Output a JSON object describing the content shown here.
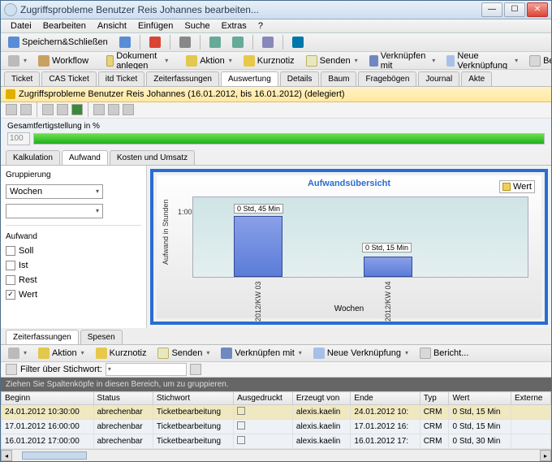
{
  "window": {
    "title": "Zugriffsprobleme Benutzer Reis Johannes bearbeiten..."
  },
  "menu": {
    "items": [
      "Datei",
      "Bearbeiten",
      "Ansicht",
      "Einfügen",
      "Suche",
      "Extras",
      "?"
    ]
  },
  "toolbar1": {
    "save_close": "Speichern&Schließen"
  },
  "toolbar2": {
    "workflow": "Workflow",
    "doc_create": "Dokument anlegen",
    "action": "Aktion",
    "shortnote": "Kurznotiz",
    "send": "Senden",
    "link_with": "Verknüpfen mit",
    "new_link": "Neue Verknüpfung",
    "report": "Bericht..."
  },
  "tabs": [
    "Ticket",
    "CAS Ticket",
    "itd Ticket",
    "Zeiterfassungen",
    "Auswertung",
    "Details",
    "Baum",
    "Fragebögen",
    "Journal",
    "Akte"
  ],
  "active_tab": "Auswertung",
  "infobar": "Zugriffsprobleme Benutzer Reis Johannes (16.01.2012, bis 16.01.2012) (delegiert)",
  "progress": {
    "label": "Gesamtfertigstellung in %",
    "value": "100"
  },
  "subtabs": [
    "Kalkulation",
    "Aufwand",
    "Kosten und Umsatz"
  ],
  "active_subtab": "Aufwand",
  "left": {
    "group_label": "Gruppierung",
    "group_value": "Wochen",
    "effort_label": "Aufwand",
    "checks": [
      {
        "label": "Soll",
        "checked": false
      },
      {
        "label": "Ist",
        "checked": false
      },
      {
        "label": "Rest",
        "checked": false
      },
      {
        "label": "Wert",
        "checked": true
      }
    ]
  },
  "chart_data": {
    "type": "bar",
    "title": "Aufwandsübersicht",
    "ylabel": "Aufwand in Stunden",
    "xlabel": "Wochen",
    "legend": [
      "Wert"
    ],
    "y_ticks": [
      "1:00"
    ],
    "categories": [
      "2012/KW 03",
      "2012/KW 04"
    ],
    "value_labels": [
      "0 Std, 45 Min",
      "0 Std, 15 Min"
    ],
    "values_minutes": [
      45,
      15
    ]
  },
  "lower_tabs": [
    "Zeiterfassungen",
    "Spesen"
  ],
  "active_lower_tab": "Zeiterfassungen",
  "lower_tb": {
    "action": "Aktion",
    "shortnote": "Kurznotiz",
    "send": "Senden",
    "link_with": "Verknüpfen mit",
    "new_link": "Neue Verknüpfung",
    "report": "Bericht..."
  },
  "filter": {
    "label": "Filter über Stichwort:"
  },
  "groupbar": "Ziehen Sie Spaltenköpfe in diesen Bereich, um zu gruppieren.",
  "columns": [
    "Beginn",
    "Status",
    "Stichwort",
    "Ausgedruckt",
    "Erzeugt von",
    "Ende",
    "Typ",
    "Wert",
    "Externe"
  ],
  "rows": [
    {
      "beginn": "24.01.2012 10:30:00",
      "status": "abrechenbar",
      "stichwort": "Ticketbearbeitung",
      "ausgedruckt": "",
      "von": "alexis.kaelin",
      "ende": "24.01.2012 10:",
      "typ": "CRM",
      "wert": "0 Std, 15  Min"
    },
    {
      "beginn": "17.01.2012 16:00:00",
      "status": "abrechenbar",
      "stichwort": "Ticketbearbeitung",
      "ausgedruckt": "",
      "von": "alexis.kaelin",
      "ende": "17.01.2012 16:",
      "typ": "CRM",
      "wert": "0 Std, 15  Min"
    },
    {
      "beginn": "16.01.2012 17:00:00",
      "status": "abrechenbar",
      "stichwort": "Ticketbearbeitung",
      "ausgedruckt": "",
      "von": "alexis.kaelin",
      "ende": "16.01.2012 17:",
      "typ": "CRM",
      "wert": "0 Std, 30  Min"
    }
  ]
}
